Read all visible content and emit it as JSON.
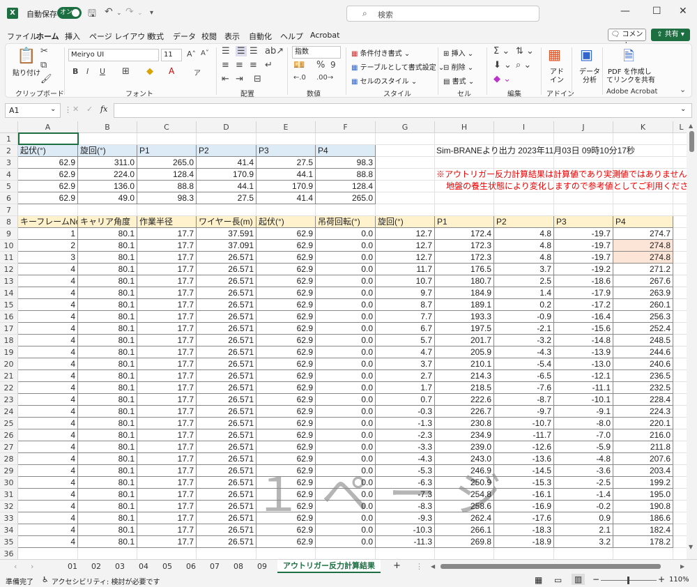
{
  "title_bar": {
    "autosave_label": "自動保存",
    "autosave_toggle": "オン",
    "search_placeholder": "検索"
  },
  "menu": [
    "ファイル",
    "ホーム",
    "挿入",
    "ページ レイアウト",
    "数式",
    "データ",
    "校閲",
    "表示",
    "自動化",
    "ヘルプ",
    "Acrobat"
  ],
  "active_menu": "ホーム",
  "buttons": {
    "comment": "コメント",
    "share": "共有"
  },
  "ribbon": {
    "paste": "貼り付け",
    "clipboard": "クリップボード",
    "font_name": "Meiryo UI",
    "font_size": "11",
    "font": "フォント",
    "align": "配置",
    "number_format": "指数",
    "number": "数値",
    "cond_format": "条件付き書式",
    "table_format": "テーブルとして書式設定",
    "cell_style": "セルのスタイル",
    "style": "スタイル",
    "insert": "挿入",
    "delete": "削除",
    "format": "書式",
    "cell": "セル",
    "edit": "編集",
    "addin_line1": "アド",
    "addin_line2": "イン",
    "addin": "アドイン",
    "data_line1": "データ",
    "data_line2": "分析",
    "pdf_line1": "PDF を作成し",
    "pdf_line2": "てリンクを共有",
    "acrobat": "Adobe Acrobat"
  },
  "name_box": "A1",
  "fx": "fx",
  "columns": [
    "A",
    "B",
    "C",
    "D",
    "E",
    "F",
    "G",
    "H",
    "I",
    "J",
    "K",
    "L"
  ],
  "rows": [
    "1",
    "2",
    "3",
    "4",
    "5",
    "6",
    "7",
    "8",
    "9",
    "10",
    "11",
    "12",
    "13",
    "14",
    "15",
    "16",
    "17",
    "18",
    "19",
    "20",
    "21",
    "22",
    "23",
    "24",
    "25",
    "26",
    "27",
    "28",
    "29",
    "30",
    "31",
    "32",
    "33",
    "34",
    "35",
    "36"
  ],
  "top_table": {
    "headers": [
      "起伏(°)",
      "旋回(°)",
      "P1",
      "P2",
      "P3",
      "P4"
    ],
    "rows": [
      [
        "62.9",
        "311.0",
        "265.0",
        "41.4",
        "27.5",
        "98.3"
      ],
      [
        "62.9",
        "224.0",
        "128.4",
        "170.9",
        "44.1",
        "88.8"
      ],
      [
        "62.9",
        "136.0",
        "88.8",
        "44.1",
        "170.9",
        "128.4"
      ],
      [
        "62.9",
        "49.0",
        "98.3",
        "27.5",
        "41.4",
        "265.0"
      ]
    ]
  },
  "output_note": "Sim-BRANEより出力 2023年11月03日 09時10分17秒",
  "warning_line1": "※アウトリガー反力計算結果は計算値であり実測値ではありません。",
  "warning_line2": "地盤の養生状態により変化しますので参考値としてご利用ください。",
  "main_table": {
    "headers": [
      "キーフレームNo",
      "キャリア角度",
      "作業半径",
      "ワイヤー長(m)",
      "起伏(°)",
      "吊荷回転(°)",
      "旋回(°)",
      "P1",
      "P2",
      "P3",
      "P4"
    ],
    "rows": [
      [
        "1",
        "80.1",
        "17.7",
        "37.591",
        "62.9",
        "0.0",
        "12.7",
        "172.4",
        "4.8",
        "-19.7",
        "274.7"
      ],
      [
        "2",
        "80.1",
        "17.7",
        "37.091",
        "62.9",
        "0.0",
        "12.7",
        "172.3",
        "4.8",
        "-19.7",
        "274.8"
      ],
      [
        "3",
        "80.1",
        "17.7",
        "26.571",
        "62.9",
        "0.0",
        "12.7",
        "172.3",
        "4.8",
        "-19.7",
        "274.8"
      ],
      [
        "4",
        "80.1",
        "17.7",
        "26.571",
        "62.9",
        "0.0",
        "11.7",
        "176.5",
        "3.7",
        "-19.2",
        "271.2"
      ],
      [
        "4",
        "80.1",
        "17.7",
        "26.571",
        "62.9",
        "0.0",
        "10.7",
        "180.7",
        "2.5",
        "-18.6",
        "267.6"
      ],
      [
        "4",
        "80.1",
        "17.7",
        "26.571",
        "62.9",
        "0.0",
        "9.7",
        "184.9",
        "1.4",
        "-17.9",
        "263.9"
      ],
      [
        "4",
        "80.1",
        "17.7",
        "26.571",
        "62.9",
        "0.0",
        "8.7",
        "189.1",
        "0.2",
        "-17.2",
        "260.1"
      ],
      [
        "4",
        "80.1",
        "17.7",
        "26.571",
        "62.9",
        "0.0",
        "7.7",
        "193.3",
        "-0.9",
        "-16.4",
        "256.3"
      ],
      [
        "4",
        "80.1",
        "17.7",
        "26.571",
        "62.9",
        "0.0",
        "6.7",
        "197.5",
        "-2.1",
        "-15.6",
        "252.4"
      ],
      [
        "4",
        "80.1",
        "17.7",
        "26.571",
        "62.9",
        "0.0",
        "5.7",
        "201.7",
        "-3.2",
        "-14.8",
        "248.5"
      ],
      [
        "4",
        "80.1",
        "17.7",
        "26.571",
        "62.9",
        "0.0",
        "4.7",
        "205.9",
        "-4.3",
        "-13.9",
        "244.6"
      ],
      [
        "4",
        "80.1",
        "17.7",
        "26.571",
        "62.9",
        "0.0",
        "3.7",
        "210.1",
        "-5.4",
        "-13.0",
        "240.6"
      ],
      [
        "4",
        "80.1",
        "17.7",
        "26.571",
        "62.9",
        "0.0",
        "2.7",
        "214.3",
        "-6.5",
        "-12.1",
        "236.5"
      ],
      [
        "4",
        "80.1",
        "17.7",
        "26.571",
        "62.9",
        "0.0",
        "1.7",
        "218.5",
        "-7.6",
        "-11.1",
        "232.5"
      ],
      [
        "4",
        "80.1",
        "17.7",
        "26.571",
        "62.9",
        "0.0",
        "0.7",
        "222.6",
        "-8.7",
        "-10.1",
        "228.4"
      ],
      [
        "4",
        "80.1",
        "17.7",
        "26.571",
        "62.9",
        "0.0",
        "-0.3",
        "226.7",
        "-9.7",
        "-9.1",
        "224.3"
      ],
      [
        "4",
        "80.1",
        "17.7",
        "26.571",
        "62.9",
        "0.0",
        "-1.3",
        "230.8",
        "-10.7",
        "-8.0",
        "220.1"
      ],
      [
        "4",
        "80.1",
        "17.7",
        "26.571",
        "62.9",
        "0.0",
        "-2.3",
        "234.9",
        "-11.7",
        "-7.0",
        "216.0"
      ],
      [
        "4",
        "80.1",
        "17.7",
        "26.571",
        "62.9",
        "0.0",
        "-3.3",
        "239.0",
        "-12.6",
        "-5.9",
        "211.8"
      ],
      [
        "4",
        "80.1",
        "17.7",
        "26.571",
        "62.9",
        "0.0",
        "-4.3",
        "243.0",
        "-13.6",
        "-4.8",
        "207.6"
      ],
      [
        "4",
        "80.1",
        "17.7",
        "26.571",
        "62.9",
        "0.0",
        "-5.3",
        "246.9",
        "-14.5",
        "-3.6",
        "203.4"
      ],
      [
        "4",
        "80.1",
        "17.7",
        "26.571",
        "62.9",
        "0.0",
        "-6.3",
        "250.9",
        "-15.3",
        "-2.5",
        "199.2"
      ],
      [
        "4",
        "80.1",
        "17.7",
        "26.571",
        "62.9",
        "0.0",
        "-7.3",
        "254.8",
        "-16.1",
        "-1.4",
        "195.0"
      ],
      [
        "4",
        "80.1",
        "17.7",
        "26.571",
        "62.9",
        "0.0",
        "-8.3",
        "258.6",
        "-16.9",
        "-0.2",
        "190.8"
      ],
      [
        "4",
        "80.1",
        "17.7",
        "26.571",
        "62.9",
        "0.0",
        "-9.3",
        "262.4",
        "-17.6",
        "0.9",
        "186.6"
      ],
      [
        "4",
        "80.1",
        "17.7",
        "26.571",
        "62.9",
        "0.0",
        "-10.3",
        "266.1",
        "-18.3",
        "2.1",
        "182.4"
      ],
      [
        "4",
        "80.1",
        "17.7",
        "26.571",
        "62.9",
        "0.0",
        "-11.3",
        "269.8",
        "-18.9",
        "3.2",
        "178.2"
      ]
    ]
  },
  "watermark": "１ページ",
  "sheet_tabs": [
    "01",
    "02",
    "03",
    "04",
    "05",
    "06",
    "07",
    "08",
    "09",
    "アウトリガー反力計算結果"
  ],
  "active_sheet": "アウトリガー反力計算結果",
  "status": {
    "ready": "準備完了",
    "accessibility": "アクセシビリティ: 検討が必要です",
    "zoom": "110%"
  }
}
